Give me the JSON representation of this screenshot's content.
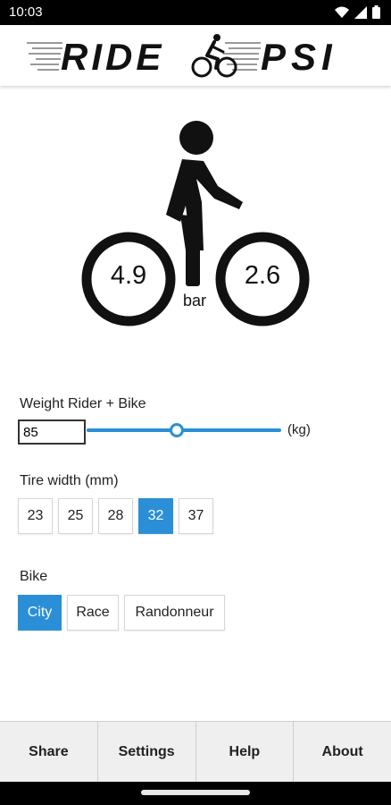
{
  "status": {
    "time": "10:03",
    "icons": [
      "wifi-icon",
      "signal-icon",
      "battery-icon"
    ]
  },
  "header": {
    "logo_text_left": "RIDE",
    "logo_text_right": "PSI"
  },
  "pressure": {
    "front": "4.9",
    "rear": "2.6",
    "unit": "bar"
  },
  "weight": {
    "label": "Weight Rider + Bike",
    "value": "85",
    "unit": "(kg)",
    "slider_fraction": 0.46
  },
  "tire": {
    "label": "Tire width (mm)",
    "options": [
      "23",
      "25",
      "28",
      "32",
      "37"
    ],
    "selected": "32"
  },
  "bike": {
    "label": "Bike",
    "options": [
      "City",
      "Race",
      "Randonneur"
    ],
    "selected": "City"
  },
  "nav": {
    "items": [
      "Share",
      "Settings",
      "Help",
      "About"
    ]
  },
  "colors": {
    "accent": "#2a8fd6"
  }
}
